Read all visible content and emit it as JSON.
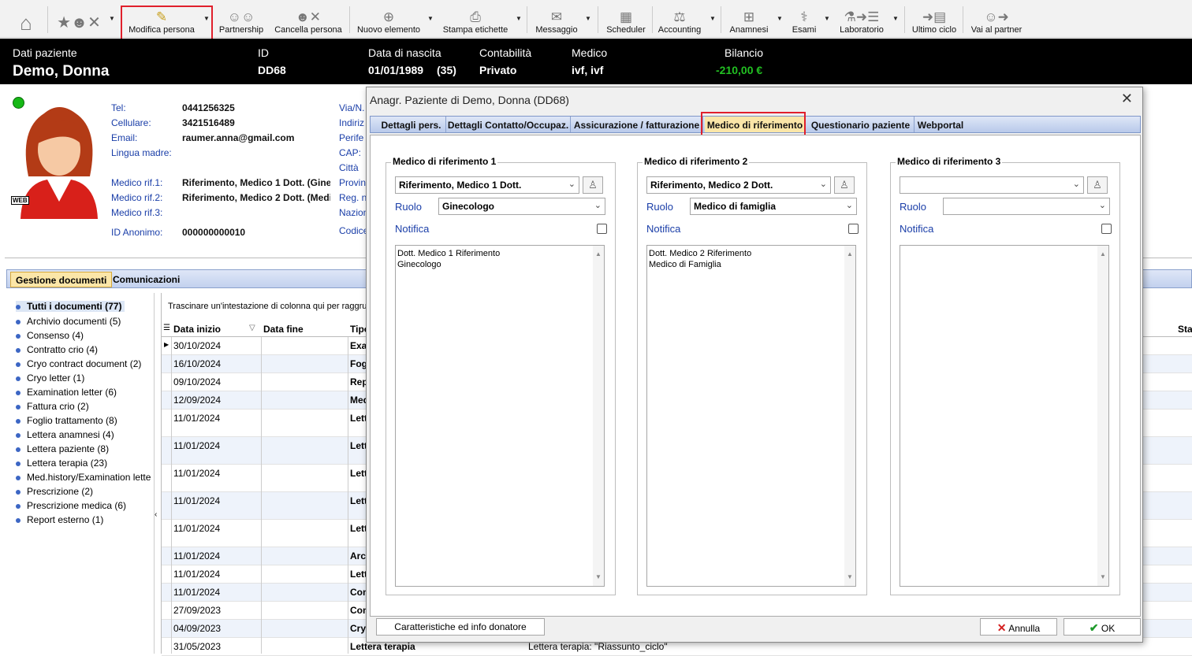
{
  "toolbar": {
    "buttons": [
      {
        "label": "",
        "icon": "home-icon"
      },
      {
        "label": "",
        "icon": "people-stars-icon"
      },
      {
        "label": "Modifica persona",
        "icon": "edit-person-icon"
      },
      {
        "label": "Partnership",
        "icon": "partnership-icon"
      },
      {
        "label": "Cancella persona",
        "icon": "delete-person-icon"
      },
      {
        "label": "Nuovo elemento",
        "icon": "new-item-icon"
      },
      {
        "label": "Stampa etichette",
        "icon": "print-labels-icon"
      },
      {
        "label": "Messaggio",
        "icon": "message-icon"
      },
      {
        "label": "Scheduler",
        "icon": "scheduler-icon"
      },
      {
        "label": "Accounting",
        "icon": "accounting-icon"
      },
      {
        "label": "Anamnesi",
        "icon": "anamnesis-icon"
      },
      {
        "label": "Esami",
        "icon": "exams-icon"
      },
      {
        "label": "Laboratorio",
        "icon": "laboratory-icon"
      },
      {
        "label": "Ultimo ciclo",
        "icon": "last-cycle-icon"
      },
      {
        "label": "Vai al partner",
        "icon": "go-partner-icon"
      }
    ]
  },
  "header": {
    "patient_label": "Dati paziente",
    "patient_name": "Demo, Donna",
    "id_label": "ID",
    "id_value": "DD68",
    "dob_label": "Data di nascita",
    "dob_value": "01/01/1989",
    "age": "(35)",
    "accounting_label": "Contabilità",
    "accounting_value": "Privato",
    "doctor_label": "Medico",
    "doctor_value": "ivf, ivf",
    "balance_label": "Bilancio",
    "balance_value": "-210,00 €",
    "balance_color": "#22c022"
  },
  "patient": {
    "web_badge": "WEB",
    "status_color": "#16b816",
    "fields": [
      {
        "label": "Tel:",
        "value": "0441256325"
      },
      {
        "label": "Cellulare:",
        "value": "3421516489"
      },
      {
        "label": "Email:",
        "value": "raumer.anna@gmail.com"
      },
      {
        "label": "Lingua madre:",
        "value": ""
      },
      {
        "label": "Medico rif.1:",
        "value": "Riferimento, Medico 1 Dott. (Gine"
      },
      {
        "label": "Medico rif.2:",
        "value": "Riferimento, Medico 2 Dott. (Medi"
      },
      {
        "label": "Medico rif.3:",
        "value": ""
      },
      {
        "label": "ID Anonimo:",
        "value": "000000000010"
      }
    ],
    "address_labels": [
      "Via/N.",
      "Indiriz",
      "Perife",
      "CAP:",
      "Città",
      "Provin",
      "Reg. n",
      "Nazion",
      "Codice"
    ]
  },
  "tabs": [
    "Gestione documenti",
    "Comunicazioni"
  ],
  "tree": [
    "Tutti i documenti (77)",
    "Archivio documenti (5)",
    "Consenso (4)",
    "Contratto crio (4)",
    "Cryo contract document (2)",
    "Cryo letter (1)",
    "Examination letter (6)",
    "Fattura crio (2)",
    "Foglio trattamento (8)",
    "Lettera anamnesi (4)",
    "Lettera paziente (8)",
    "Lettera terapia (23)",
    "Med.history/Examination lette",
    "Prescrizione (2)",
    "Prescrizione medica (6)",
    "Report esterno (1)"
  ],
  "grid": {
    "group_hint": "Trascinare un'intestazione di colonna qui per raggru",
    "columns": [
      "Data inizio",
      "Data fine",
      "Tipo",
      "Sta"
    ],
    "rows": [
      {
        "date": "30/10/2024",
        "type": "Exa"
      },
      {
        "date": "16/10/2024",
        "type": "Fog"
      },
      {
        "date": "09/10/2024",
        "type": "Rep"
      },
      {
        "date": "12/09/2024",
        "type": "Med"
      },
      {
        "date": "11/01/2024",
        "type": "Lett"
      },
      {
        "date": "11/01/2024",
        "type": "Lett"
      },
      {
        "date": "11/01/2024",
        "type": "Lett"
      },
      {
        "date": "11/01/2024",
        "type": "Lett"
      },
      {
        "date": "11/01/2024",
        "type": "Lett"
      },
      {
        "date": "11/01/2024",
        "type": "Arc"
      },
      {
        "date": "11/01/2024",
        "type": "Lett"
      },
      {
        "date": "11/01/2024",
        "type": "Con"
      },
      {
        "date": "27/09/2023",
        "type": "Con"
      },
      {
        "date": "04/09/2023",
        "type": "Cry"
      },
      {
        "date": "31/05/2023",
        "type": "Lettera terapia",
        "desc": "Lettera terapia: \"Riassunto_ciclo\""
      }
    ]
  },
  "dialog": {
    "title": "Anagr. Paziente di Demo, Donna (DD68)",
    "tabs": [
      "Dettagli pers.",
      "Dettagli Contatto/Occupaz.",
      "Assicurazione / fatturazione",
      "Medico di riferimento",
      "Questionario paziente",
      "Webportal"
    ],
    "groups": [
      {
        "title": "Medico di riferimento 1",
        "doctor": "Riferimento, Medico 1 Dott.",
        "role_label": "Ruolo",
        "role": "Ginecologo",
        "notify_label": "Notifica",
        "notes": [
          "Dott. Medico 1 Riferimento",
          "Ginecologo"
        ]
      },
      {
        "title": "Medico di riferimento 2",
        "doctor": "Riferimento, Medico 2 Dott.",
        "role_label": "Ruolo",
        "role": "Medico di famiglia",
        "notify_label": "Notifica",
        "notes": [
          "Dott. Medico 2 Riferimento",
          "Medico di Famiglia"
        ]
      },
      {
        "title": "Medico di riferimento 3",
        "doctor": "",
        "role_label": "Ruolo",
        "role": "",
        "notify_label": "Notifica",
        "notes": [
          "",
          ""
        ]
      }
    ],
    "donor_button": "Caratteristiche ed info donatore",
    "cancel_button": "Annulla",
    "ok_button": "OK",
    "cancel_color": "#d42020",
    "ok_color": "#1d9a2a"
  }
}
